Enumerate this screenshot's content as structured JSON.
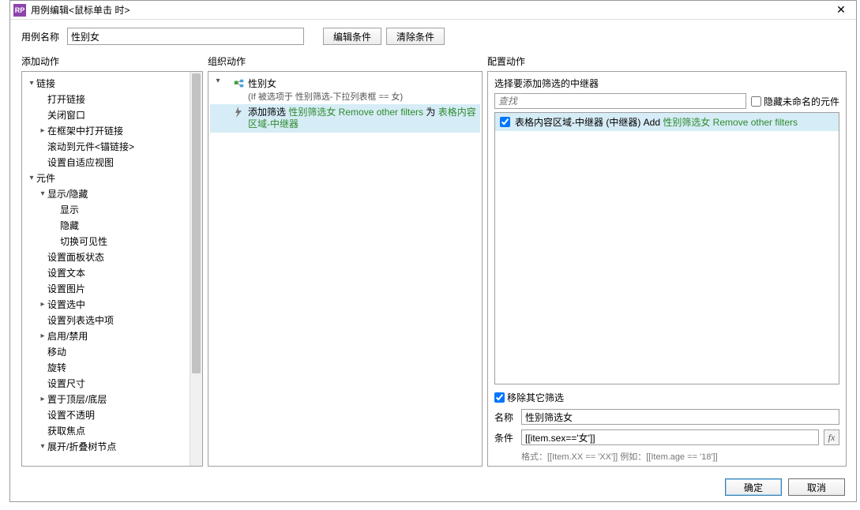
{
  "window": {
    "title": "用例编辑<鼠标单击 时>",
    "icon_label": "RP"
  },
  "toprow": {
    "name_label": "用例名称",
    "name_value": "性别女",
    "edit_condition": "编辑条件",
    "clear_condition": "清除条件"
  },
  "col_labels": {
    "add_action": "添加动作",
    "org_action": "组织动作",
    "cfg_action": "配置动作"
  },
  "add_tree": [
    {
      "t": "链接",
      "a": "open",
      "d": 0
    },
    {
      "t": "打开链接",
      "a": "none",
      "d": 1
    },
    {
      "t": "关闭窗口",
      "a": "none",
      "d": 1
    },
    {
      "t": "在框架中打开链接",
      "a": "closed",
      "d": 1
    },
    {
      "t": "滚动到元件<锚链接>",
      "a": "none",
      "d": 1
    },
    {
      "t": "设置自适应视图",
      "a": "none",
      "d": 1
    },
    {
      "t": "元件",
      "a": "open",
      "d": 0
    },
    {
      "t": "显示/隐藏",
      "a": "open",
      "d": 1
    },
    {
      "t": "显示",
      "a": "none",
      "d": 2
    },
    {
      "t": "隐藏",
      "a": "none",
      "d": 2
    },
    {
      "t": "切换可见性",
      "a": "none",
      "d": 2
    },
    {
      "t": "设置面板状态",
      "a": "none",
      "d": 1
    },
    {
      "t": "设置文本",
      "a": "none",
      "d": 1
    },
    {
      "t": "设置图片",
      "a": "none",
      "d": 1
    },
    {
      "t": "设置选中",
      "a": "closed",
      "d": 1
    },
    {
      "t": "设置列表选中项",
      "a": "none",
      "d": 1
    },
    {
      "t": "启用/禁用",
      "a": "closed",
      "d": 1
    },
    {
      "t": "移动",
      "a": "none",
      "d": 1
    },
    {
      "t": "旋转",
      "a": "none",
      "d": 1
    },
    {
      "t": "设置尺寸",
      "a": "none",
      "d": 1
    },
    {
      "t": "置于顶层/底层",
      "a": "closed",
      "d": 1
    },
    {
      "t": "设置不透明",
      "a": "none",
      "d": 1
    },
    {
      "t": "获取焦点",
      "a": "none",
      "d": 1
    },
    {
      "t": "展开/折叠树节点",
      "a": "open",
      "d": 1
    }
  ],
  "org": {
    "case_name": "性别女",
    "condition": "(If 被选项于 性别筛选-下拉列表框 == 女)",
    "action_prefix": "添加筛选 ",
    "action_green1": "性别筛选女 Remove other filters",
    "action_mid": " 为 ",
    "action_green2": "表格内容区域-中继器"
  },
  "cfg": {
    "select_label": "选择要添加筛选的中继器",
    "search_placeholder": "查找",
    "hide_unnamed": "隐藏未命名的元件",
    "result_prefix": "表格内容区域-中继器 (中继器) Add ",
    "result_green": "性别筛选女 Remove other filters",
    "remove_other": "移除其它筛选",
    "name_label": "名称",
    "name_value": "性别筛选女",
    "cond_label": "条件",
    "cond_value": "[[item.sex=='女']]",
    "fx_label": "fx",
    "hint": "格式：[[Item.XX == 'XX']] 例如：[[Item.age == '18']]"
  },
  "footer": {
    "ok": "确定",
    "cancel": "取消"
  }
}
